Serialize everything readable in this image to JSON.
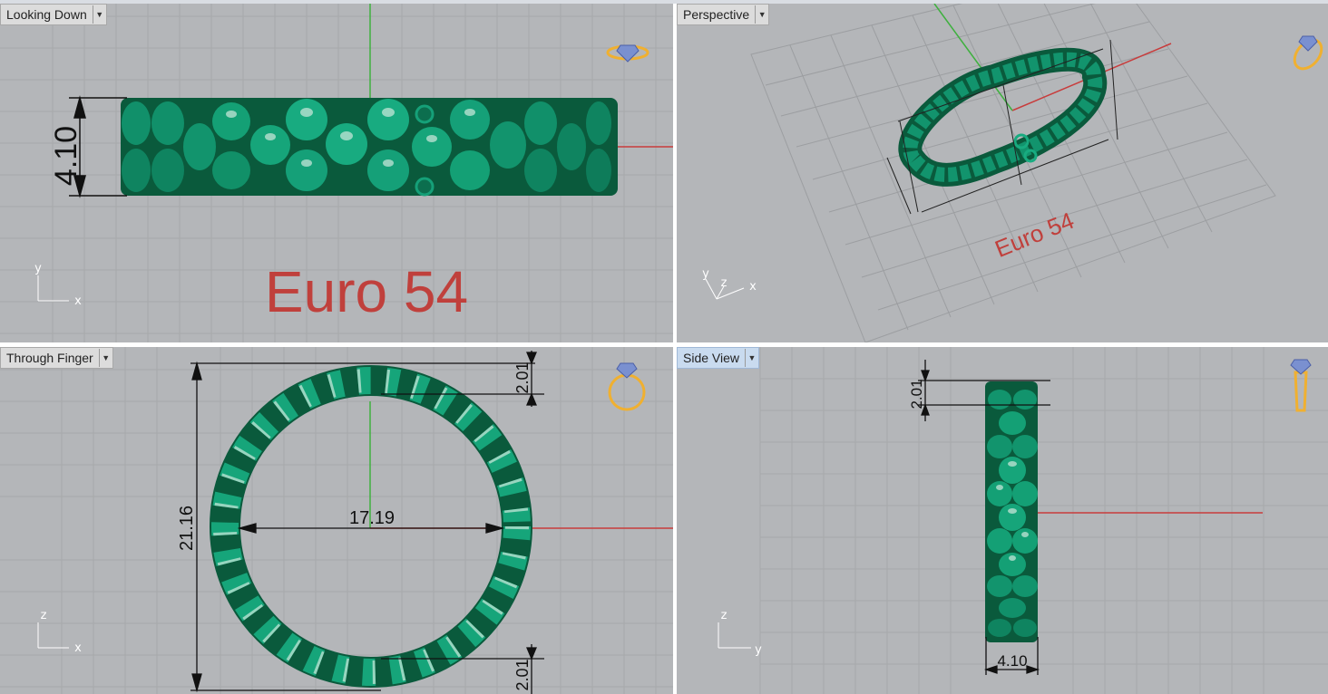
{
  "viewports": {
    "top_left": {
      "title": "Looking Down",
      "dim_height": "4.10",
      "annotation": "Euro 54",
      "axis_v": "y",
      "axis_h": "x"
    },
    "top_right": {
      "title": "Perspective",
      "annotation": "Euro 54",
      "axis_v": "y",
      "axis_z": "z",
      "axis_h": "x"
    },
    "bottom_left": {
      "title": "Through Finger",
      "dim_outer": "21.16",
      "dim_inner": "17.19",
      "dim_top": "2.01",
      "dim_bottom": "2.01",
      "axis_v": "z",
      "axis_h": "x"
    },
    "bottom_right": {
      "title": "Side View",
      "dim_top": "2.01",
      "dim_width": "4.10",
      "axis_v": "z",
      "axis_h": "y"
    }
  },
  "icons": [
    "ring-top-icon",
    "ring-perspective-icon",
    "ring-front-icon",
    "ring-side-icon",
    "dropdown-arrow-icon"
  ],
  "colors": {
    "viewport_bg": "#b4b6b9",
    "grid": "#a4a6a9",
    "ring": "#0b7a52",
    "axis_x": "#c83c3c",
    "axis_y": "#3fb03f",
    "annotation": "#c0403c",
    "icon": "#f0b030"
  }
}
